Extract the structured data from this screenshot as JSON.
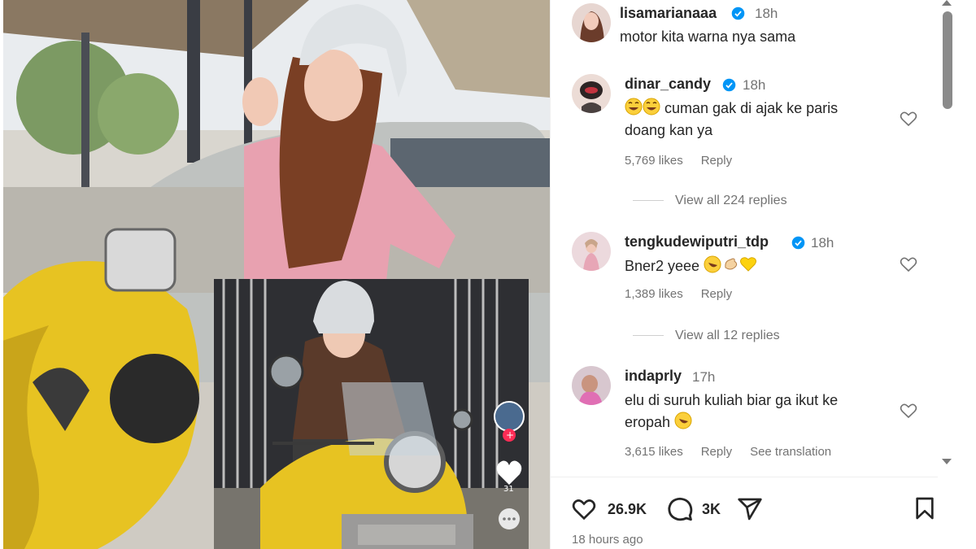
{
  "post": {
    "author": "lisamarianaaa",
    "time": "18h",
    "caption": "motor kita warna nya sama"
  },
  "media": {
    "inset_side_count": "31"
  },
  "comments": [
    {
      "username": "dinar_candy",
      "verified": true,
      "time": "18h",
      "text_line1": "cuman gak di ajak ke paris",
      "text_line2": "doang kan ya",
      "likes": "5,769 likes",
      "reply": "Reply",
      "view_replies": "View all 224 replies"
    },
    {
      "username": "tengkudewiputri_tdp",
      "verified": true,
      "time": "18h",
      "text": "Bner2 yeee",
      "likes": "1,389 likes",
      "reply": "Reply",
      "view_replies": "View all 12 replies"
    },
    {
      "username": "indaprly",
      "verified": false,
      "time": "17h",
      "text_line1": "elu di suruh kuliah biar ga ikut ke",
      "text_line2": "eropah",
      "likes": "3,615 likes",
      "reply": "Reply",
      "translation": "See translation"
    }
  ],
  "actions": {
    "like_count": "26.9K",
    "comment_count": "3K",
    "posted_ago": "18 hours ago"
  },
  "icons": [
    "heart-icon",
    "comment-icon",
    "share-icon",
    "bookmark-icon",
    "verified-badge-icon"
  ],
  "colors": {
    "verified": "#0095f6",
    "scooter_yellow": "#e7c322",
    "muted_text": "#737373"
  }
}
